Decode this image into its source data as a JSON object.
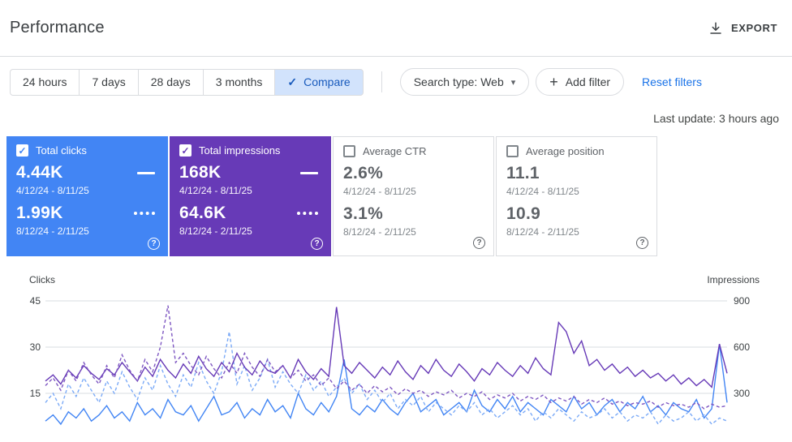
{
  "header": {
    "title": "Performance",
    "export_label": "EXPORT"
  },
  "icons": {
    "check": "✓",
    "plus": "+",
    "dropdown_caret": "▾",
    "help": "?"
  },
  "filters": {
    "ranges": [
      "24 hours",
      "7 days",
      "28 days",
      "3 months"
    ],
    "compare_label": "Compare",
    "search_type_label": "Search type: Web",
    "add_filter_label": "Add filter",
    "reset_label": "Reset filters",
    "last_update": "Last update: 3 hours ago"
  },
  "cards": [
    {
      "label": "Total clicks",
      "checked": true,
      "value1": "4.44K",
      "range1": "4/12/24 - 8/11/25",
      "value2": "1.99K",
      "range2": "8/12/24 - 2/11/25",
      "color": "#4285f4"
    },
    {
      "label": "Total impressions",
      "checked": true,
      "value1": "168K",
      "range1": "4/12/24 - 8/11/25",
      "value2": "64.6K",
      "range2": "8/12/24 - 2/11/25",
      "color": "#673ab7"
    },
    {
      "label": "Average CTR",
      "checked": false,
      "value1": "2.6%",
      "range1": "4/12/24 - 8/11/25",
      "value2": "3.1%",
      "range2": "8/12/24 - 2/11/25",
      "color": "#ffffff"
    },
    {
      "label": "Average position",
      "checked": false,
      "value1": "11.1",
      "range1": "4/12/24 - 8/11/25",
      "value2": "10.9",
      "range2": "8/12/24 - 2/11/25",
      "color": "#ffffff"
    }
  ],
  "chart_data": {
    "type": "line",
    "left_axis": {
      "label": "Clicks",
      "ticks": [
        45,
        30,
        15
      ],
      "min": 0,
      "max": 45
    },
    "right_axis": {
      "label": "Impressions",
      "ticks": [
        900,
        600,
        300
      ],
      "min": 0,
      "max": 900
    },
    "grid": true,
    "series": [
      {
        "name": "Total clicks 4/12/24 - 8/11/25",
        "axis": "left",
        "style": "solid",
        "color": "#4285f4",
        "values": [
          6,
          8,
          5,
          9,
          7,
          10,
          6,
          8,
          11,
          7,
          9,
          6,
          12,
          8,
          10,
          7,
          13,
          9,
          8,
          11,
          6,
          10,
          14,
          8,
          9,
          12,
          7,
          10,
          8,
          13,
          9,
          11,
          7,
          15,
          10,
          8,
          12,
          9,
          14,
          26,
          10,
          8,
          11,
          9,
          13,
          10,
          8,
          12,
          15,
          9,
          11,
          13,
          8,
          10,
          12,
          9,
          16,
          11,
          9,
          13,
          10,
          14,
          9,
          12,
          10,
          8,
          13,
          11,
          9,
          14,
          10,
          12,
          8,
          11,
          13,
          9,
          12,
          10,
          14,
          9,
          11,
          8,
          12,
          10,
          9,
          13,
          7,
          10,
          31,
          12
        ]
      },
      {
        "name": "Total clicks 8/12/24 - 2/11/25",
        "axis": "left",
        "style": "dashed",
        "color": "#7baaf7",
        "values": [
          12,
          15,
          10,
          18,
          14,
          20,
          16,
          12,
          19,
          15,
          22,
          17,
          13,
          20,
          16,
          24,
          18,
          14,
          21,
          17,
          25,
          19,
          15,
          22,
          35,
          18,
          24,
          16,
          20,
          26,
          17,
          22,
          18,
          15,
          21,
          16,
          19,
          14,
          17,
          20,
          15,
          18,
          13,
          16,
          12,
          15,
          10,
          13,
          11,
          14,
          9,
          12,
          10,
          8,
          11,
          9,
          12,
          8,
          10,
          7,
          9,
          11,
          8,
          10,
          6,
          9,
          7,
          10,
          8,
          6,
          9,
          7,
          8,
          10,
          7,
          9,
          6,
          8,
          7,
          9,
          5,
          8,
          6,
          7,
          9,
          6,
          8,
          5,
          7,
          6
        ]
      },
      {
        "name": "Total impressions 4/12/24 - 8/11/25",
        "axis": "right",
        "style": "solid",
        "color": "#673ab7",
        "values": [
          380,
          420,
          360,
          450,
          400,
          480,
          430,
          390,
          460,
          420,
          500,
          440,
          380,
          470,
          410,
          520,
          450,
          400,
          490,
          430,
          540,
          460,
          410,
          500,
          440,
          560,
          470,
          420,
          510,
          450,
          430,
          480,
          400,
          520,
          440,
          390,
          460,
          410,
          860,
          480,
          430,
          500,
          450,
          400,
          470,
          420,
          510,
          440,
          390,
          480,
          430,
          520,
          450,
          410,
          490,
          440,
          380,
          460,
          420,
          500,
          450,
          410,
          480,
          430,
          530,
          460,
          420,
          760,
          700,
          560,
          640,
          480,
          520,
          450,
          490,
          430,
          470,
          410,
          450,
          400,
          430,
          380,
          420,
          360,
          400,
          350,
          390,
          340,
          620,
          430
        ]
      },
      {
        "name": "Total impressions 8/12/24 - 2/11/25",
        "axis": "right",
        "style": "dashed",
        "color": "#7e57c2",
        "values": [
          350,
          400,
          320,
          450,
          380,
          500,
          420,
          360,
          480,
          400,
          550,
          450,
          380,
          520,
          440,
          600,
          870,
          500,
          560,
          480,
          420,
          540,
          460,
          400,
          500,
          430,
          560,
          470,
          410,
          520,
          440,
          480,
          400,
          450,
          380,
          420,
          350,
          400,
          330,
          380,
          320,
          360,
          300,
          350,
          310,
          340,
          290,
          330,
          300,
          320,
          280,
          310,
          290,
          320,
          270,
          300,
          280,
          310,
          260,
          290,
          270,
          300,
          250,
          280,
          260,
          290,
          240,
          270,
          250,
          280,
          230,
          260,
          240,
          270,
          230,
          250,
          220,
          240,
          230,
          250,
          210,
          240,
          220,
          230,
          210,
          240,
          200,
          230,
          210,
          220
        ]
      }
    ]
  }
}
